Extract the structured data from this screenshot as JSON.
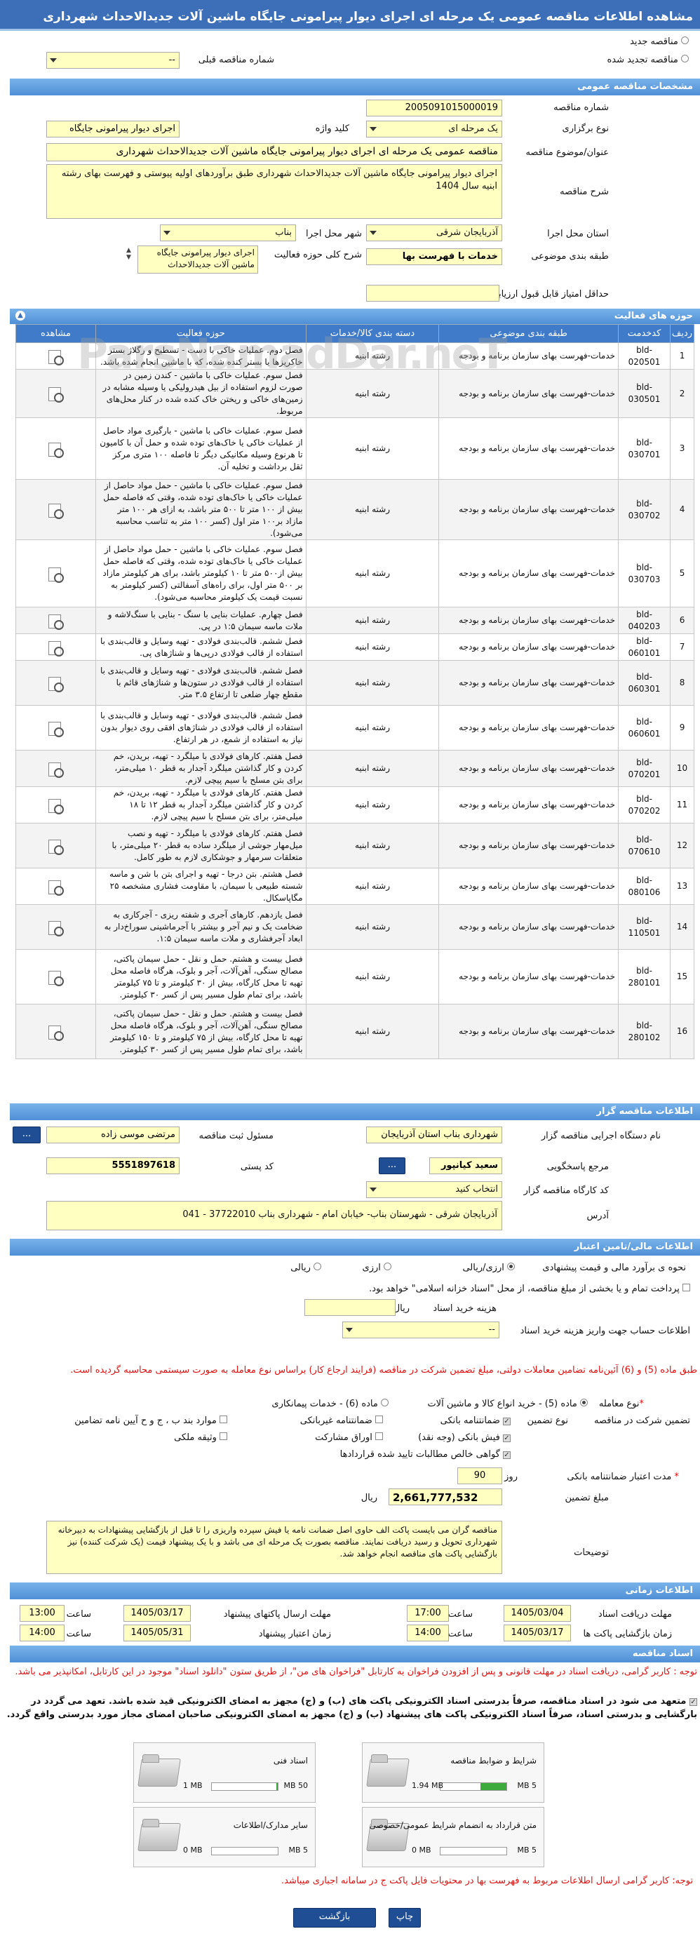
{
  "page_title": "مشاهده اطلاعات مناقصه عمومی یک مرحله ای اجرای دیوار پیرامونی جایگاه ماشین آلات جدیدالاحداث شهرداری",
  "radios": {
    "new": "مناقصه جدید",
    "renewed": "مناقصه تجدید شده",
    "prev_label": "شماره مناقصه قبلی",
    "prev_value": "--"
  },
  "sections": {
    "general": "مشخصات مناقصه عمومی",
    "activities": "حوزه های فعالیت",
    "organizer": "اطلاعات مناقصه گزار",
    "financial": "اطلاعات مالی/تامین اعتبار",
    "timing": "اطلاعات زمانی",
    "docs": "اسناد مناقصه"
  },
  "general": {
    "number_label": "شماره مناقصه",
    "number": "2005091015000019",
    "type_label": "نوع برگزاری",
    "type": "یک مرحله ای",
    "keyword_label": "کلید واژه",
    "keyword": "اجرای دیوار پیرامونی جایگاه",
    "subject_label": "عنوان/موضوع مناقصه",
    "subject": "مناقصه عمومی یک مرحله ای اجرای دیوار پیرامونی جایگاه ماشین آلات جدیدالاحداث شهرداری",
    "desc_label": "شرح مناقصه",
    "desc": "اجرای دیوار پیرامونی جایگاه ماشین آلات جدیدالاحداث شهرداری طبق برآوردهای اولیه پیوستی و فهرست بهای رشته ابنیه سال 1404",
    "province_label": "استان محل اجرا",
    "province": "آذربایجان شرقی",
    "city_label": "شهر محل اجرا",
    "city": "بناب",
    "category_label": "طبقه بندی موضوعی",
    "category": "خدمات با فهرست بها",
    "activity_label": "شرح کلی حوزه فعالیت",
    "activity_lines": [
      "اجرای دیوار پیرامونی جایگاه",
      "ماشین آلات جدیدالاحداث"
    ],
    "min_score_label": "حداقل امتیاز قابل قبول ارزیابی فنی/بازرگانی",
    "min_score": ""
  },
  "table": {
    "headers": [
      "ردیف",
      "کدخدمت",
      "طبقه بندی موضوعی",
      "دسته بندی کالا/خدمات",
      "حوزه فعالیت",
      "مشاهده"
    ],
    "rows": [
      {
        "n": "1",
        "code": "bld-020501",
        "cat": "خدمات-فهرست بهای سازمان برنامه و بودجه",
        "group": "رشته ابنیه",
        "act": "فصل دوم. عملیات خاکی با دست - تسطیح و رگلاژ بستر خاکریزها یا بستر کنده شده، که با ماشین انجام شده باشد."
      },
      {
        "n": "2",
        "code": "bld-030501",
        "cat": "خدمات-فهرست بهای سازمان برنامه و بودجه",
        "group": "رشته ابنیه",
        "act": "فصل سوم. عملیات خاکی با ماشین - کندن زمین در صورت لزوم استفاده از بیل هیدرولیکی یا وسیله مشابه در زمین‌های خاکی و ریختن خاک کنده شده در کنار محل‌های مربوط."
      },
      {
        "n": "3",
        "code": "bld-030701",
        "cat": "خدمات-فهرست بهای سازمان برنامه و بودجه",
        "group": "رشته ابنیه",
        "act": "فصل سوم. عملیات خاکی با ماشین - بارگیری مواد حاصل از عملیات خاکی یا خاک‌های توده شده و حمل آن با کامیون تا هرنوع وسیله مکانیکی دیگر تا فاصله ۱۰۰ متری مرکز ثقل برداشت و تخلیه آن."
      },
      {
        "n": "4",
        "code": "bld-030702",
        "cat": "خدمات-فهرست بهای سازمان برنامه و بودجه",
        "group": "رشته ابنیه",
        "act": "فصل سوم. عملیات خاکی با ماشین - حمل مواد حاصل از عملیات خاکی یا خاک‌های توده شده، وقتی که فاصله حمل بیش از ۱۰۰ متر تا ۵۰۰ متر باشد، به ازای هر ۱۰۰ متر مازاد بر۱۰۰ متر اول (کسر ۱۰۰ متر به تناسب محاسبه می‌شود)."
      },
      {
        "n": "5",
        "code": "bld-030703",
        "cat": "خدمات-فهرست بهای سازمان برنامه و بودجه",
        "group": "رشته ابنیه",
        "act": "فصل سوم. عملیات خاکی با ماشین - حمل مواد حاصل از عملیات خاکی یا خاک‌های توده شده، وقتی که فاصله حمل بیش از۵۰۰ متر تا ۱۰ کیلومتر باشد، برای هر کیلومتر مازاد بر ۵۰۰ متر اول، برای راه‌های آسفالتی (کسر کیلومتر به نسبت قیمت یک کیلومتر محاسبه می‌شود)."
      },
      {
        "n": "6",
        "code": "bld-040203",
        "cat": "خدمات-فهرست بهای سازمان برنامه و بودجه",
        "group": "رشته ابنیه",
        "act": "فصل چهارم. عملیات بنایی با سنگ - بنایی با سنگ‌لاشه و ملات ماسه سیمان ۱:۵ در پی."
      },
      {
        "n": "7",
        "code": "bld-060101",
        "cat": "خدمات-فهرست بهای سازمان برنامه و بودجه",
        "group": "رشته ابنیه",
        "act": "فصل ششم. قالب‌بندی فولادی - تهیه وسایل و قالب‌بندی با استفاده از قالب فولادی درپی‌ها و شناژهای پی."
      },
      {
        "n": "8",
        "code": "bld-060301",
        "cat": "خدمات-فهرست بهای سازمان برنامه و بودجه",
        "group": "رشته ابنیه",
        "act": "فصل ششم. قالب‌بندی فولادی - تهیه وسایل و قالب‌بندی با استفاده از قالب فولادی در ستون‌ها و شناژهای قائم با مقطع چهار ضلعی تا ارتفاع ۳.۵ متر."
      },
      {
        "n": "9",
        "code": "bld-060601",
        "cat": "خدمات-فهرست بهای سازمان برنامه و بودجه",
        "group": "رشته ابنیه",
        "act": "فصل ششم. قالب‌بندی فولادی - تهیه وسایل و قالب‌بندی با استفاده از قالب فولادی در شناژهای افقی روی دیوار بدون نیاز به استفاده از شمع، در هر ارتفاع."
      },
      {
        "n": "10",
        "code": "bld-070201",
        "cat": "خدمات-فهرست بهای سازمان برنامه و بودجه",
        "group": "رشته ابنیه",
        "act": "فصل هفتم. کارهای فولادی با میلگرد - تهیه، بریدن، خم کردن و کار گذاشتن میلگرد آجدار به قطر ۱۰ میلی‌متر، برای بتن مسلح با سیم پیچی لازم."
      },
      {
        "n": "11",
        "code": "bld-070202",
        "cat": "خدمات-فهرست بهای سازمان برنامه و بودجه",
        "group": "رشته ابنیه",
        "act": "فصل هفتم. کارهای فولادی با میلگرد - تهیه، بریدن، خم کردن و کار گذاشتن میلگرد آجدار به قطر ۱۲ تا ۱۸ میلی‌متر، برای بتن مسلح با سیم پیچی لازم."
      },
      {
        "n": "12",
        "code": "bld-070610",
        "cat": "خدمات-فهرست بهای سازمان برنامه و بودجه",
        "group": "رشته ابنیه",
        "act": "فصل هفتم. کارهای فولادی با میلگرد - تهیه و نصب میل‌مهار جوشی از میلگرد ساده به قطر ۲۰ میلی‌متر، با متعلقات سرمهار و جوشکاری لازم به طور کامل."
      },
      {
        "n": "13",
        "code": "bld-080106",
        "cat": "خدمات-فهرست بهای سازمان برنامه و بودجه",
        "group": "رشته ابنیه",
        "act": "فصل هشتم. بتن درجا - تهیه و اجرای بتن با شن و ماسه شسته طبیعی با سیمان، با مقاومت فشاری مشخصه ۲۵ مگاپاسکال."
      },
      {
        "n": "14",
        "code": "bld-110501",
        "cat": "خدمات-فهرست بهای سازمان برنامه و بودجه",
        "group": "رشته ابنیه",
        "act": "فصل یازدهم. کارهای آجری و شفته ریزی - آجرکاری به ضخامت یک و نیم آجر و بیشتر با آجرماشینی سوراخ‌دار به ابعاد آجرفشاری و ملات ماسه سیمان ۱:۵."
      },
      {
        "n": "15",
        "code": "bld-280101",
        "cat": "خدمات-فهرست بهای سازمان برنامه و بودجه",
        "group": "رشته ابنیه",
        "act": "فصل بیست و هشتم. حمل و نقل - حمل سیمان پاکتی، مصالح سنگی، آهن‌آلات، آجر و بلوک، هرگاه فاصله محل تهیه تا محل کارگاه، بیش از ۳۰ کیلومتر و تا ۷۵ کیلومتر باشد، برای تمام طول مسیر پس از کسر ۳۰ کیلومتر."
      },
      {
        "n": "16",
        "code": "bld-280102",
        "cat": "خدمات-فهرست بهای سازمان برنامه و بودجه",
        "group": "رشته ابنیه",
        "act": "فصل بیست و هشتم. حمل و نقل - حمل سیمان پاکتی، مصالح سنگی، آهن‌آلات، آجر و بلوک، هرگاه فاصله محل تهیه تا محل کارگاه، بیش از ۷۵ کیلومتر و تا ۱۵۰ کیلومتر باشد، برای تمام طول مسیر پس از کسر ۳۰ کیلومتر."
      }
    ]
  },
  "organizer": {
    "org_label": "نام دستگاه اجرایی مناقصه گزار",
    "org": "شهرداری بناب استان آذربایجان",
    "resp_label": "مسئول ثبت مناقصه",
    "resp": "مرتضی موسی زاده",
    "ref_label": "مرجع پاسخگویی",
    "ref": "سعید کیانپور",
    "postal_label": "کد پستی",
    "postal": "5551897618",
    "workshop_label": "کد کارگاه مناقصه گزار",
    "workshop": "انتخاب کنید",
    "address_label": "آدرس",
    "address": "آذربایجان شرقی - شهرستان بناب-  خیابان امام - شهرداری بناب 37722010 - 041",
    "more_btn": "...",
    "browse_btn": "..."
  },
  "financial": {
    "estimate_label": "نحوه ی برآورد مالی و قیمت پیشنهادی",
    "opt_rial": "ارزی/ریالی",
    "opt_fx": "ارزی",
    "opt_only_rial": "ریالی",
    "treasury": "پرداخت تمام و یا بخشی از مبلغ مناقصه، از محل \"اسناد خزانه اسلامی\" خواهد بود.",
    "doc_fee_label": "هزینه خرید اسناد",
    "doc_fee_unit": "ریال",
    "doc_fee": "",
    "account_label": "اطلاعات حساب جهت واریز هزینه خرید اسناد",
    "account": "--",
    "red_note": "طبق ماده (5) و (6) آئین‌نامه تضامین معاملات دولتی، مبلغ تضمین شرکت در مناقصه (فرایند ارجاع کار) براساس نوع معامله به صورت سیستمی محاسبه گردیده است.",
    "deal_label": "نوع معامله",
    "deal_opt1": "ماده (5) - خرید انواع کالا و ماشین آلات",
    "deal_opt2": "ماده (6) - خدمات پیمانکاری",
    "guar_label": "تضمین شرکت در مناقصه",
    "guar_type_label": "نوع تضمین",
    "g1": "ضمانتنامه بانکی",
    "g2": "ضمانتنامه غیربانکی",
    "g3": "موارد بند ب ، ج و ح آیین نامه تضامین",
    "g4": "فیش بانکی (وجه نقد)",
    "g5": "اوراق مشارکت",
    "g6": "وثیقه ملکی",
    "g7": "گواهی خالص مطالبات تایید شده قراردادها",
    "validity_label": "مدت اعتبار ضمانتنامه بانکی",
    "validity": "90",
    "validity_unit": "روز",
    "amount_label": "مبلغ تضمین",
    "amount": "2,661,777,532",
    "amount_unit": "ریال",
    "notes_label": "توضیحات",
    "notes": "مناقصه گران می بایست پاکت الف حاوی اصل ضمانت نامه یا فیش سپرده واریزی را تا قبل از بازگشایی پیشنهادات به دبیرخانه شهرداری تحویل و رسید دریافت نمایند. مناقصه بصورت یک مرحله ای می باشد و با یک پیشنهاد قیمت (یک شرکت کننده) نیز بازگشایی پاکت های مناقصه انجام خواهد شد."
  },
  "timing": {
    "recv_label": "مهلت دریافت اسناد",
    "recv_date": "1405/03/04",
    "recv_time": "17:00",
    "send_label": "مهلت ارسال پاکتهای پیشنهاد",
    "send_date": "1405/03/17",
    "send_time": "13:00",
    "open_label": "زمان بازگشایی پاکت ها",
    "open_date": "1405/03/17",
    "open_time": "14:00",
    "valid_label": "زمان اعتبار پیشنهاد",
    "valid_date": "1405/05/31",
    "valid_time": "14:00",
    "time_label": "ساعت"
  },
  "docs": {
    "note1": "توجه : کاربر گرامی، دریافت اسناد در مهلت قانونی و پس از افزودن فراخوان به کارتابل \"فراخوان های من\"، از طریق ستون \"دانلود اسناد\" موجود در این کارتابل، امکانپذیر می باشد.",
    "commit": "متعهد می شود در اسناد مناقصه، صرفاً بدرستی اسناد الکترونیکی پاکت های (ب) و (ج) مجهز به امضای الکترونیکی قید شده باشد. تعهد می گردد در بارگشایی و بدرستی اسناد، صرفاً اسناد الکترونیکی پاکت های پیشنهاد (ب) و (ج) مجهز به امضای الکترونیکی صاحبان امضای مجاز مورد بدرستی واقع گردد.",
    "boxes": [
      {
        "title": "شرایط و ضوابط مناقصه",
        "used": "1.94 MB",
        "max": "5 MB",
        "fill": 0.39
      },
      {
        "title": "اسناد فنی",
        "used": "1 MB",
        "max": "50 MB",
        "fill": 0.02
      },
      {
        "title": "متن قرارداد به انضمام شرایط عمومی/خصوصی",
        "used": "0 MB",
        "max": "5 MB",
        "fill": 0
      },
      {
        "title": "سایر مدارک/اطلاعات",
        "used": "0 MB",
        "max": "5 MB",
        "fill": 0
      }
    ],
    "note2": "توجه: کاربر گرامی ارسال اطلاعات مربوط به فهرست بها در محتویات فایل پاکت ج در سامانه اجباری میباشد."
  },
  "footer": {
    "print": "چاپ",
    "back": "بازگشت"
  },
  "watermark": "ParsNamadDar.neT"
}
